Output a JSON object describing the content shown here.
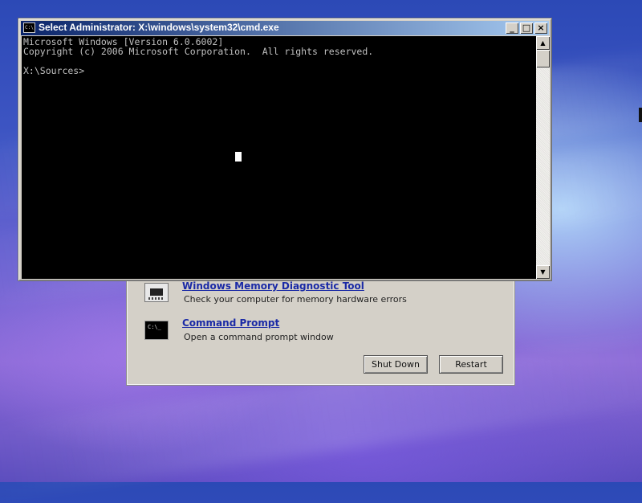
{
  "cmd_window": {
    "title": "Select Administrator: X:\\windows\\system32\\cmd.exe",
    "icon_text": "C:\\.",
    "buttons": {
      "minimize": "_",
      "maximize": "□",
      "close": "×"
    },
    "console_lines": [
      "Microsoft Windows [Version 6.0.6002]",
      "Copyright (c) 2006 Microsoft Corporation.  All rights reserved.",
      "",
      "X:\\Sources>"
    ],
    "scroll_up": "▲",
    "scroll_down": "▼"
  },
  "recovery": {
    "items": [
      {
        "title": "Windows Memory Diagnostic Tool",
        "description": "Check your computer for memory hardware errors",
        "icon": "memory-chip-icon"
      },
      {
        "title": "Command Prompt",
        "description": "Open a command prompt window",
        "icon": "command-prompt-icon",
        "icon_text": "C:\\_"
      }
    ],
    "buttons": {
      "shutdown": "Shut Down",
      "restart": "Restart"
    }
  }
}
